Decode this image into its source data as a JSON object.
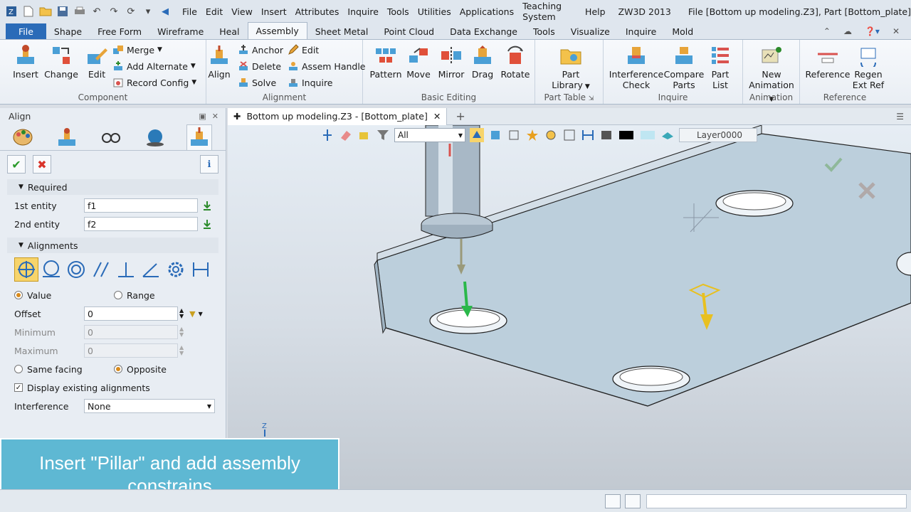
{
  "titlebar": {
    "menu": [
      "File",
      "Edit",
      "View",
      "Insert",
      "Attributes",
      "Inquire",
      "Tools",
      "Utilities",
      "Applications",
      "Teaching System",
      "Help"
    ],
    "app_name": "ZW3D 2013",
    "doc_title": "File [Bottom up modeling.Z3],  Part [Bottom_plate]"
  },
  "tabs": [
    "File",
    "Shape",
    "Free Form",
    "Wireframe",
    "Heal",
    "Assembly",
    "Sheet Metal",
    "Point Cloud",
    "Data Exchange",
    "Tools",
    "Visualize",
    "Inquire",
    "Mold"
  ],
  "active_tab": "Assembly",
  "ribbon": {
    "component": {
      "label": "Component",
      "insert": "Insert",
      "change": "Change",
      "edit": "Edit",
      "merge": "Merge",
      "add_alternate": "Add Alternate",
      "record_config": "Record Config"
    },
    "alignment": {
      "label": "Alignment",
      "align": "Align",
      "anchor": "Anchor",
      "delete": "Delete",
      "solve": "Solve",
      "edit": "Edit",
      "assem_handle": "Assem Handle",
      "inquire": "Inquire"
    },
    "basic_editing": {
      "label": "Basic Editing",
      "pattern": "Pattern",
      "move": "Move",
      "mirror": "Mirror",
      "drag": "Drag",
      "rotate": "Rotate"
    },
    "part_table": {
      "label": "Part Table",
      "part_library_1": "Part",
      "part_library_2": "Library"
    },
    "inquire": {
      "label": "Inquire",
      "interference_1": "Interference",
      "interference_2": "Check",
      "compare_1": "Compare",
      "compare_2": "Parts",
      "part_list_1": "Part",
      "part_list_2": "List"
    },
    "animation": {
      "label": "Animation",
      "new_1": "New",
      "new_2": "Animation"
    },
    "reference": {
      "label": "Reference",
      "reference": "Reference",
      "regen_1": "Regen",
      "regen_2": "Ext Ref"
    }
  },
  "panel": {
    "title": "Align",
    "required": "Required",
    "first_entity_label": "1st entity",
    "first_entity_value": "f1",
    "second_entity_label": "2nd entity",
    "second_entity_value": "f2",
    "alignments": "Alignments",
    "value_label": "Value",
    "range_label": "Range",
    "offset_label": "Offset",
    "offset_value": "0",
    "minimum_label": "Minimum",
    "minimum_value": "0",
    "maximum_label": "Maximum",
    "maximum_value": "0",
    "same_facing": "Same facing",
    "opposite": "Opposite",
    "display_existing": "Display existing alignments",
    "interference_label": "Interference",
    "interference_value": "None"
  },
  "doc_tab": "Bottom up modeling.Z3 - [Bottom_plate]",
  "viewport": {
    "filter_value": "All",
    "layer": "Layer0000",
    "axis_label": "Z"
  },
  "caption": {
    "line1": "Insert \"Pillar\"    and add assembly",
    "line2": "constrains"
  },
  "colors": {
    "file_tab": "#2a6bb8",
    "caption_bg": "#5eb8d3",
    "selected_align": "#f7d46b"
  }
}
